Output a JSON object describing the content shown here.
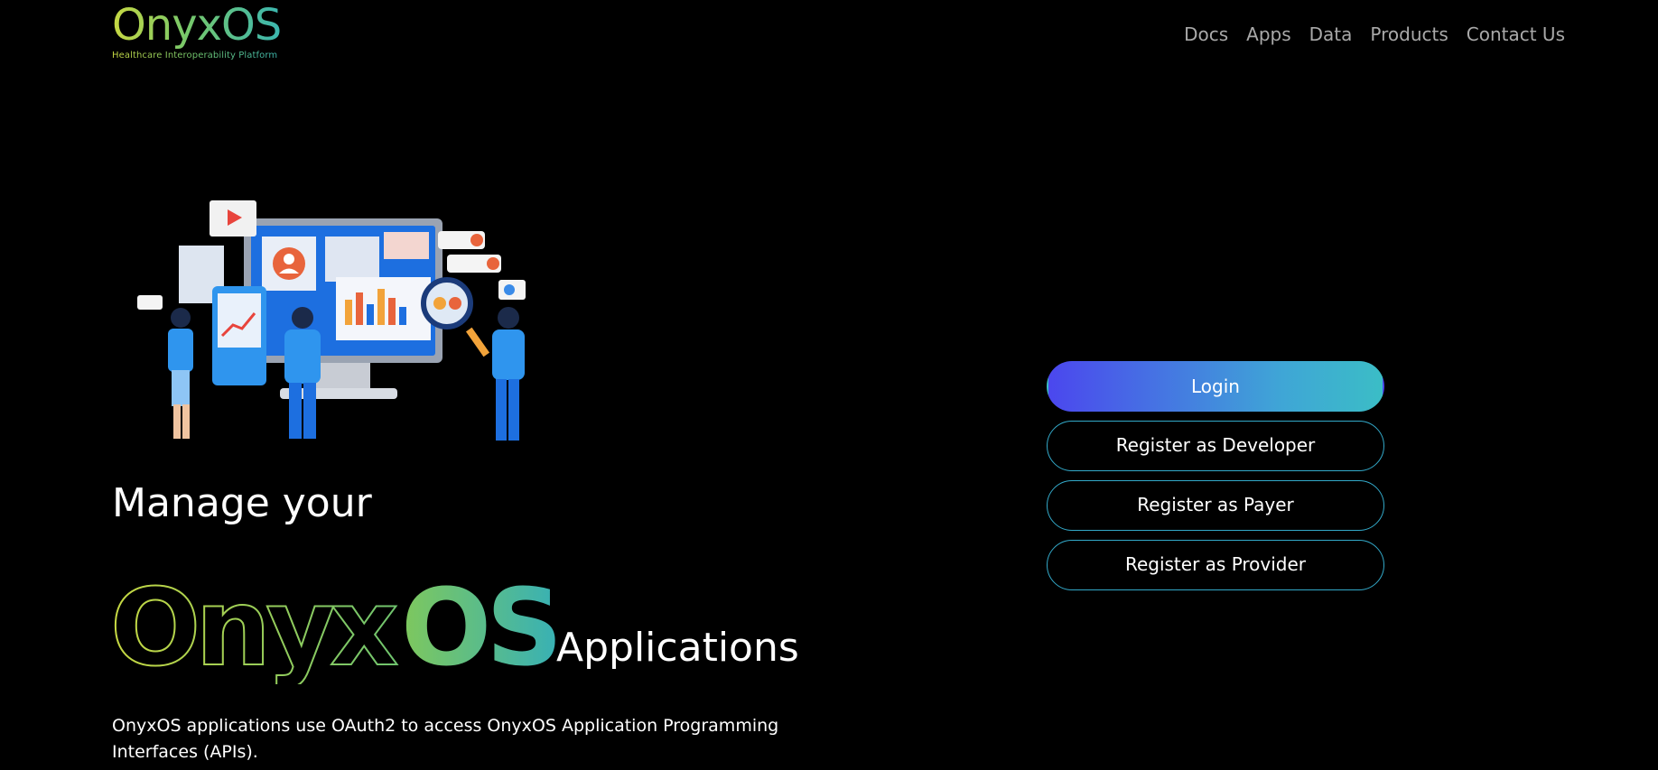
{
  "logo": {
    "wordmark": "OnyxOS",
    "tagline": "Healthcare Interoperability Platform"
  },
  "nav": {
    "items": [
      {
        "label": "Docs"
      },
      {
        "label": "Apps"
      },
      {
        "label": "Data"
      },
      {
        "label": "Products"
      },
      {
        "label": "Contact Us"
      }
    ]
  },
  "hero": {
    "line1": "Manage your",
    "brand_outline": "Onyx",
    "brand_solid": "OS",
    "line2": "Applications",
    "description": "OnyxOS applications use OAuth2 to access OnyxOS Application Programming Interfaces (APIs)."
  },
  "actions": {
    "login": "Login",
    "register_developer": "Register as Developer",
    "register_payer": "Register as Payer",
    "register_provider": "Register as Provider"
  },
  "colors": {
    "background": "#000000",
    "nav_text": "#a9a9a9",
    "brand_green": "#c7d842",
    "brand_teal": "#3bb6b0",
    "button_start": "#4b47ee",
    "button_end": "#3bbdc6",
    "button_border": "#33a9c9"
  }
}
